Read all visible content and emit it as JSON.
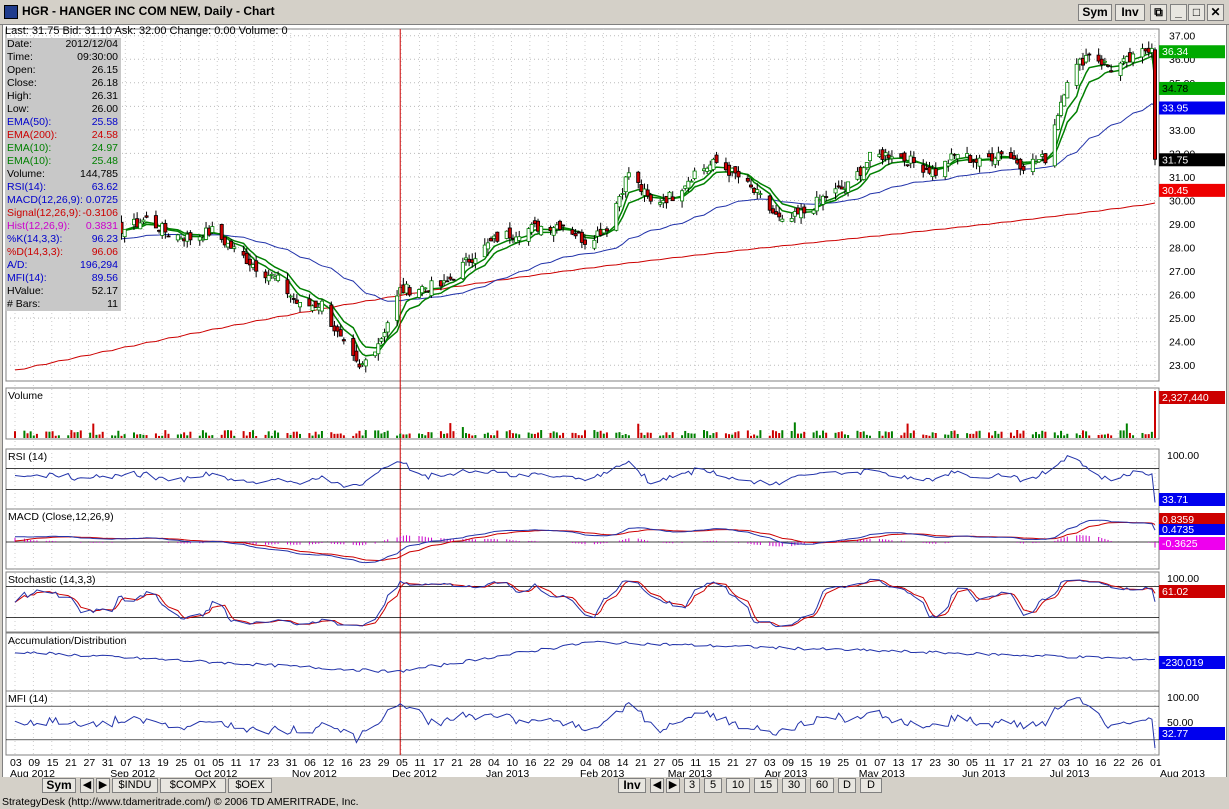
{
  "window": {
    "title": "HGR - HANGER INC COM NEW, Daily - Chart",
    "sym_label": "Sym",
    "inv_label": "Inv"
  },
  "quote": {
    "last": "Last: 31.75",
    "bid": "Bid: 31.10",
    "ask": "Ask: 32.00",
    "change": "Change: 0.00",
    "volume": "Volume: 0"
  },
  "data_window": [
    {
      "label": "Date:",
      "value": "2012/12/04",
      "color": "#000000"
    },
    {
      "label": "Time:",
      "value": "09:30:00",
      "color": "#000000"
    },
    {
      "label": "Open:",
      "value": "26.15",
      "color": "#000000"
    },
    {
      "label": "Close:",
      "value": "26.18",
      "color": "#000000"
    },
    {
      "label": "High:",
      "value": "26.31",
      "color": "#000000"
    },
    {
      "label": "Low:",
      "value": "26.00",
      "color": "#000000"
    },
    {
      "label": "EMA(50):",
      "value": "25.58",
      "color": "#0000cc"
    },
    {
      "label": "EMA(200):",
      "value": "24.58",
      "color": "#cc0000"
    },
    {
      "label": "EMA(10):",
      "value": "24.97",
      "color": "#008000"
    },
    {
      "label": "EMA(10):",
      "value": "25.48",
      "color": "#008000"
    },
    {
      "label": "Volume:",
      "value": "144,785",
      "color": "#000000"
    },
    {
      "label": "RSI(14):",
      "value": "63.62",
      "color": "#0000cc"
    },
    {
      "label": "MACD(12,26,9):",
      "value": "0.0725",
      "color": "#0000cc"
    },
    {
      "label": "Signal(12,26,9):",
      "value": "-0.3106",
      "color": "#cc0000"
    },
    {
      "label": "Hist(12,26,9):",
      "value": "0.3831",
      "color": "#cc00cc"
    },
    {
      "label": "%K(14,3,3):",
      "value": "96.23",
      "color": "#0000cc"
    },
    {
      "label": "%D(14,3,3):",
      "value": "96.06",
      "color": "#cc0000"
    },
    {
      "label": "A/D:",
      "value": "196,294",
      "color": "#0000cc"
    },
    {
      "label": "MFI(14):",
      "value": "89.56",
      "color": "#0000cc"
    },
    {
      "label": "HValue:",
      "value": "52.17",
      "color": "#000000"
    },
    {
      "label": "# Bars:",
      "value": "11",
      "color": "#000000"
    }
  ],
  "chart_data": {
    "type": "candlestick",
    "title": "HGR - HANGER INC COM NEW, Daily - Chart",
    "price_ticks": [
      "37.00",
      "36.00",
      "35.00",
      "34.00",
      "33.00",
      "32.00",
      "31.00",
      "30.00",
      "29.00",
      "28.00",
      "27.00",
      "26.00",
      "25.00",
      "24.00",
      "23.00"
    ],
    "price_range": [
      22.5,
      37.2
    ],
    "price_path": [
      [
        "2012-08-03",
        28.4
      ],
      [
        "2012-08-10",
        28.8
      ],
      [
        "2012-08-17",
        28.9
      ],
      [
        "2012-08-24",
        28.6
      ],
      [
        "2012-08-31",
        28.7
      ],
      [
        "2012-09-07",
        28.8
      ],
      [
        "2012-09-14",
        29.2
      ],
      [
        "2012-09-21",
        28.6
      ],
      [
        "2012-09-28",
        28.4
      ],
      [
        "2012-10-05",
        28.7
      ],
      [
        "2012-10-12",
        27.9
      ],
      [
        "2012-10-19",
        27.2
      ],
      [
        "2012-10-26",
        26.6
      ],
      [
        "2012-11-02",
        25.5
      ],
      [
        "2012-11-09",
        25.6
      ],
      [
        "2012-11-16",
        23.8
      ],
      [
        "2012-11-21",
        22.8
      ],
      [
        "2012-11-28",
        24.2
      ],
      [
        "2012-12-04",
        26.18
      ],
      [
        "2012-12-11",
        26.3
      ],
      [
        "2012-12-18",
        26.4
      ],
      [
        "2012-12-26",
        27.5
      ],
      [
        "2013-01-04",
        28.4
      ],
      [
        "2013-01-11",
        28.7
      ],
      [
        "2013-01-18",
        28.9
      ],
      [
        "2013-01-25",
        29.0
      ],
      [
        "2013-02-01",
        28.3
      ],
      [
        "2013-02-08",
        28.9
      ],
      [
        "2013-02-15",
        31.2
      ],
      [
        "2013-02-22",
        29.9
      ],
      [
        "2013-03-01",
        30.2
      ],
      [
        "2013-03-08",
        31.2
      ],
      [
        "2013-03-15",
        31.6
      ],
      [
        "2013-03-22",
        31.0
      ],
      [
        "2013-03-29",
        30.1
      ],
      [
        "2013-04-05",
        29.0
      ],
      [
        "2013-04-12",
        29.5
      ],
      [
        "2013-04-19",
        30.2
      ],
      [
        "2013-04-26",
        30.6
      ],
      [
        "2013-05-03",
        31.8
      ],
      [
        "2013-05-10",
        32.0
      ],
      [
        "2013-05-17",
        31.6
      ],
      [
        "2013-05-24",
        31.2
      ],
      [
        "2013-05-31",
        32.0
      ],
      [
        "2013-06-07",
        31.6
      ],
      [
        "2013-06-14",
        32.1
      ],
      [
        "2013-06-21",
        31.5
      ],
      [
        "2013-06-28",
        31.8
      ],
      [
        "2013-07-05",
        35.2
      ],
      [
        "2013-07-12",
        36.3
      ],
      [
        "2013-07-19",
        35.6
      ],
      [
        "2013-07-26",
        36.0
      ],
      [
        "2013-08-01",
        36.6
      ],
      [
        "2013-08-02",
        31.75
      ]
    ],
    "ema_10_close": 34.78,
    "ema_10_b": 36.34,
    "ema_50": 33.95,
    "ema_200": 30.45,
    "last": 31.75,
    "panels": [
      {
        "name": "Volume",
        "value": "2,327,440"
      },
      {
        "name": "RSI (14)",
        "scale_top": "100.00",
        "value": "33.71"
      },
      {
        "name": "MACD (Close,12,26,9)",
        "value_macd": "0.8359",
        "value_signal": "0.4735",
        "value_hist": "-0.3625"
      },
      {
        "name": "Stochastic (14,3,3)",
        "scale_top": "100.00",
        "value": "61.02"
      },
      {
        "name": "Accumulation/Distribution",
        "value": "-230,019"
      },
      {
        "name": "MFI (14)",
        "scale_top": "100.00",
        "scale_mid": "50.00",
        "value": "32.77"
      }
    ],
    "x_day_labels": [
      "03",
      "09",
      "15",
      "21",
      "27",
      "31",
      "07",
      "13",
      "19",
      "25",
      "01",
      "05",
      "11",
      "17",
      "23",
      "31",
      "06",
      "12",
      "16",
      "23",
      "29",
      "05",
      "11",
      "17",
      "21",
      "28",
      "04",
      "10",
      "16",
      "22",
      "29",
      "04",
      "08",
      "14",
      "21",
      "27",
      "05",
      "11",
      "15",
      "21",
      "27",
      "03",
      "09",
      "15",
      "19",
      "25",
      "01",
      "07",
      "13",
      "17",
      "23",
      "30",
      "05",
      "11",
      "17",
      "21",
      "27",
      "03",
      "10",
      "16",
      "22",
      "26",
      "01"
    ],
    "x_month_labels": [
      "Aug 2012",
      "Sep 2012",
      "Oct 2012",
      "Nov 2012",
      "Dec 2012",
      "Jan 2013",
      "Feb 2013",
      "Mar 2013",
      "Apr 2013",
      "May 2013",
      "Jun 2013",
      "Jul 2013",
      "Aug 2013"
    ]
  },
  "colors": {
    "up": "#008000",
    "down": "#cc0000",
    "ema50": "#2233aa",
    "ema200": "#cc0000",
    "ema10": "#008000",
    "ema10_tag": "#00aa00",
    "ema50_tag": "#0000ee",
    "last_tag": "#000000",
    "ema200_tag": "#ee0000"
  },
  "bottom_bar": {
    "sym_label": "Sym",
    "tabs": [
      "$INDU",
      "$COMPX",
      "$OEX"
    ],
    "inv_label": "Inv",
    "periods": [
      "3",
      "5",
      "10",
      "15",
      "30",
      "60",
      "D",
      "D"
    ]
  },
  "status_bar": "StrategyDesk (http://www.tdameritrade.com/) © 2006 TD AMERITRADE, Inc."
}
